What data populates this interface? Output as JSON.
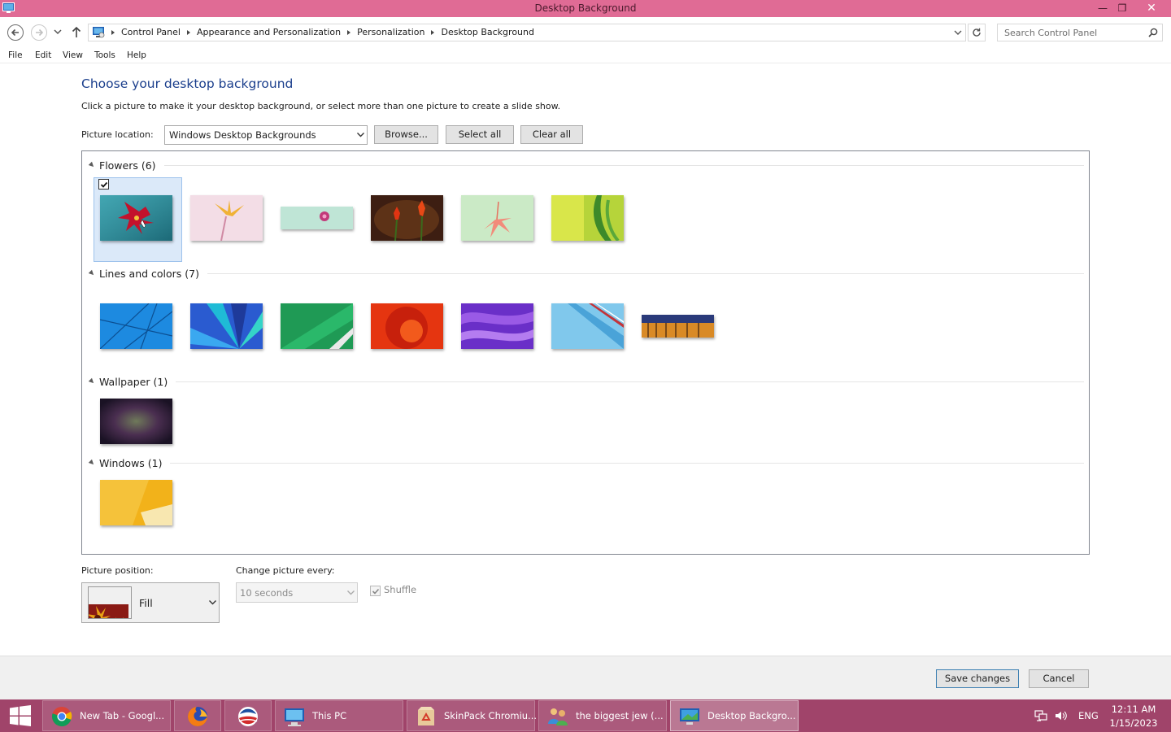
{
  "window": {
    "title": "Desktop Background",
    "controls": {
      "minimize": "—",
      "restore": "❐",
      "close": "✕"
    }
  },
  "address_bar": {
    "breadcrumbs": [
      "Control Panel",
      "Appearance and Personalization",
      "Personalization",
      "Desktop Background"
    ],
    "search_placeholder": "Search Control Panel"
  },
  "menu": [
    "File",
    "Edit",
    "View",
    "Tools",
    "Help"
  ],
  "main": {
    "heading": "Choose your desktop background",
    "subtitle": "Click a picture to make it your desktop background, or select more than one picture to create a slide show.",
    "picture_location_label": "Picture location:",
    "picture_location_value": "Windows Desktop Backgrounds",
    "browse_label": "Browse...",
    "select_all_label": "Select all",
    "clear_all_label": "Clear all"
  },
  "gallery": {
    "groups": [
      {
        "title": "Flowers (6)",
        "count": 6,
        "selected_index": 0,
        "thumb_colors": [
          "#2e8f9e",
          "#f1d9e2",
          "#bfe3d6",
          "#5a2a14",
          "#cfe9c9",
          "#b8d43a"
        ]
      },
      {
        "title": "Lines and colors (7)",
        "count": 7,
        "thumb_colors": [
          "#2a8fe0",
          "#3a7fd8",
          "#1f9a55",
          "#e03a10",
          "#7a3ad0",
          "#7ec6ea",
          "#c88a2a"
        ]
      },
      {
        "title": "Wallpaper (1)",
        "count": 1,
        "thumb_colors": [
          "#2b1f33"
        ]
      },
      {
        "title": "Windows (1)",
        "count": 1,
        "thumb_colors": [
          "#f2b21a"
        ]
      }
    ]
  },
  "options": {
    "picture_position_label": "Picture position:",
    "picture_position_value": "Fill",
    "change_picture_label": "Change picture every:",
    "change_picture_value": "10 seconds",
    "shuffle_label": "Shuffle",
    "shuffle_checked": true
  },
  "footer": {
    "save_label": "Save changes",
    "cancel_label": "Cancel"
  },
  "taskbar": {
    "items": [
      {
        "label": "New Tab - Googl...",
        "icon": "chrome-icon"
      },
      {
        "label": "",
        "icon": "firefox-icon"
      },
      {
        "label": "",
        "icon": "campaign-logo-icon"
      },
      {
        "label": "This PC",
        "icon": "this-pc-icon"
      },
      {
        "label": "SkinPack Chromiu...",
        "icon": "recycle-package-icon"
      },
      {
        "label": "the biggest jew (...",
        "icon": "people-icon"
      },
      {
        "label": "Desktop Backgro...",
        "icon": "desktop-background-icon",
        "active": true
      }
    ],
    "language": "ENG",
    "time": "12:11 AM",
    "date": "1/15/2023"
  },
  "colors": {
    "titlebar": "#e06b95",
    "taskbar": "#a0446a",
    "heading": "#1a3e8c",
    "selection": "#dbe9f9"
  }
}
